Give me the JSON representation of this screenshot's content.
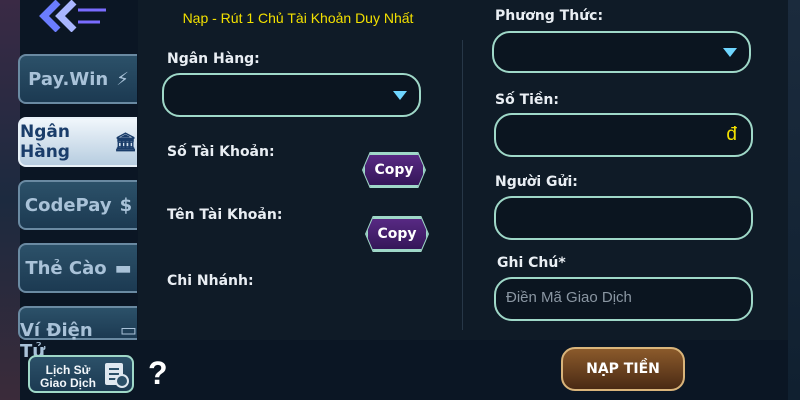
{
  "sidebar": {
    "items": [
      {
        "label": "Pay.Win",
        "icon": "lightning-icon"
      },
      {
        "label": "Ngân Hàng",
        "icon": "bank-icon"
      },
      {
        "label": "CodePay",
        "icon": "coin-icon"
      },
      {
        "label": "Thẻ Cào",
        "icon": "card-icon"
      },
      {
        "label": "Ví Điện Tử",
        "icon": "wallet-icon"
      }
    ],
    "active": "Ngân Hàng"
  },
  "form": {
    "title": "Nạp - Rút 1 Chủ Tài Khoản Duy Nhất",
    "bank_label": "Ngân Hàng:",
    "account_number_label": "Số Tài Khoản:",
    "account_name_label": "Tên Tài Khoản:",
    "branch_label": "Chi Nhánh:",
    "copy_label": "Copy",
    "method_label": "Phương Thức:",
    "amount_label": "Số Tiền:",
    "currency": "đ",
    "sender_label": "Người Gửi:",
    "note_label": "Ghi Chú*",
    "note_placeholder": "Điền Mã Giao Dịch"
  },
  "footer": {
    "history_line1": "Lịch Sử",
    "history_line2": "Giao Dịch",
    "help": "?",
    "submit_label": "NẠP TIỀN"
  },
  "colors": {
    "accent": "#f2e000",
    "field_border": "#9fd8c8",
    "panel": "#0f1b27"
  }
}
